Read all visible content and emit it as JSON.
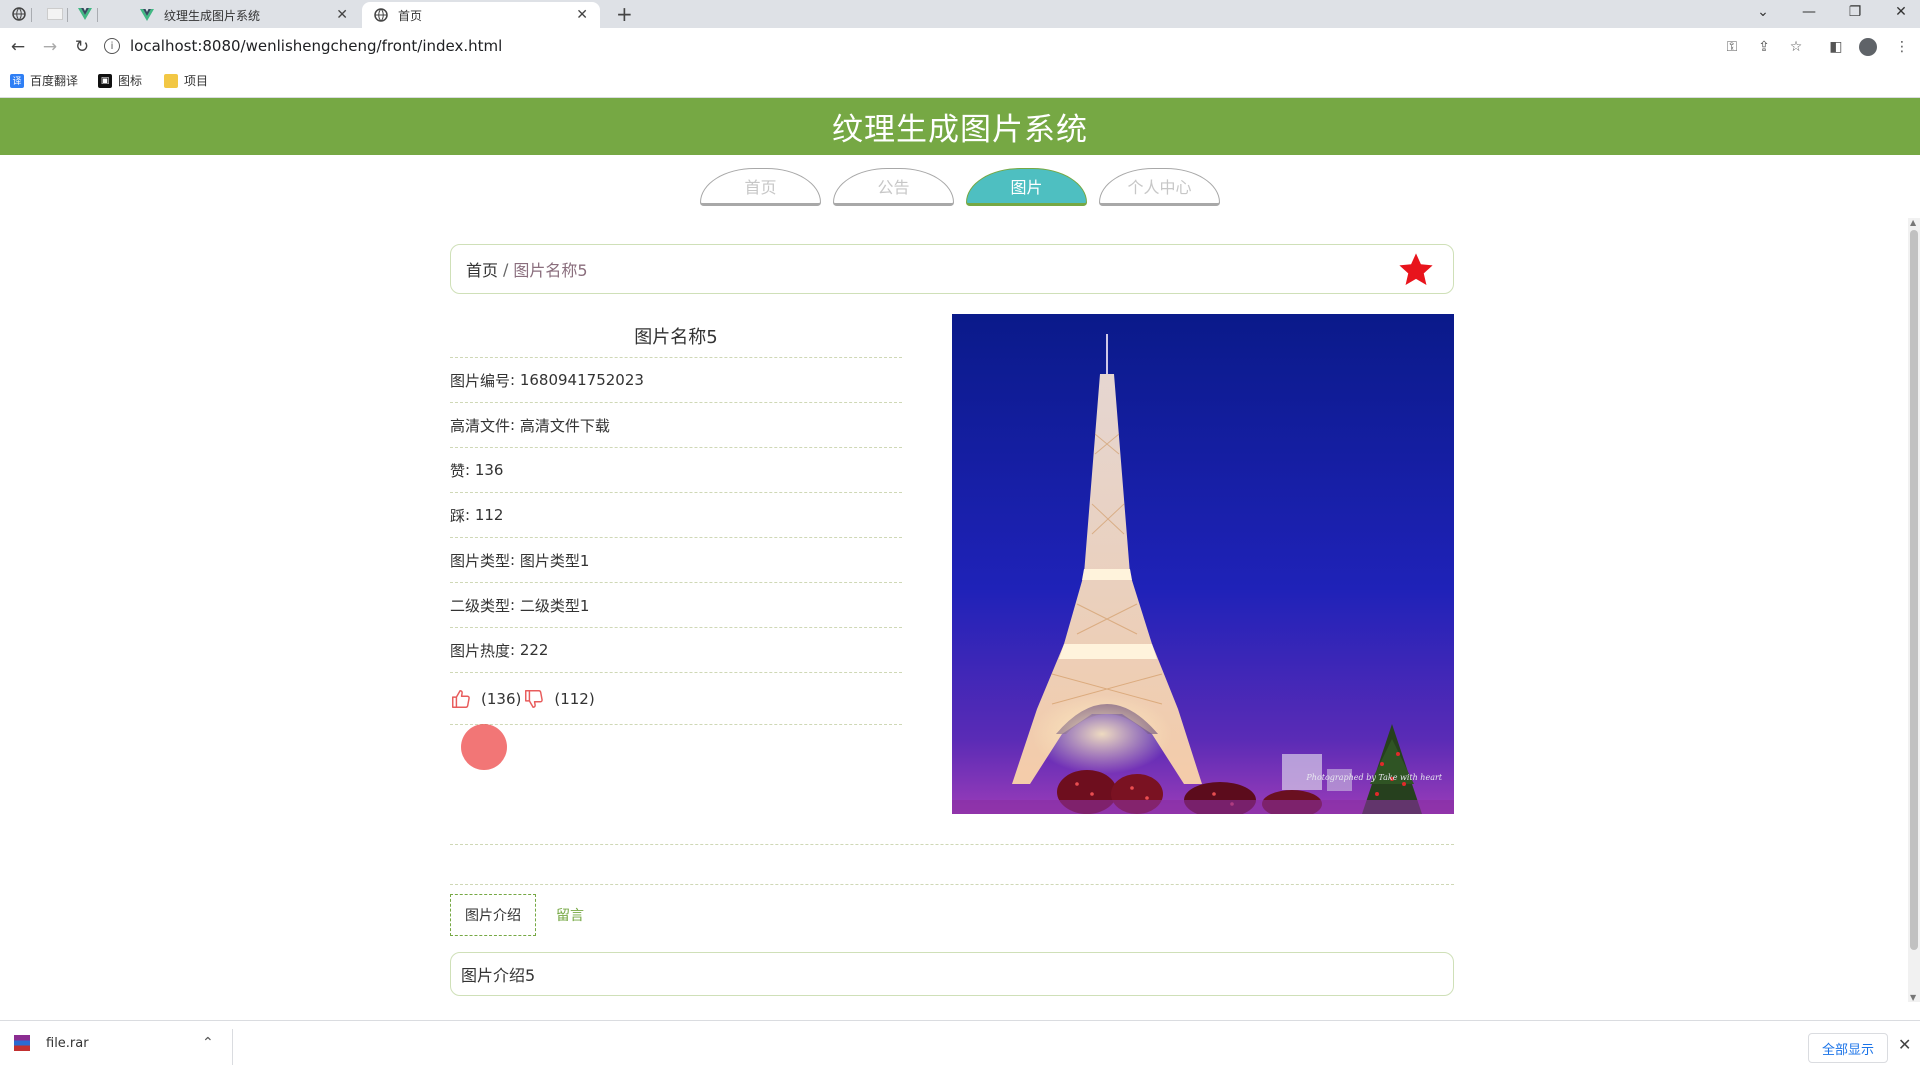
{
  "browser": {
    "tabs": [
      {
        "title": "纹理生成图片系统",
        "active": false
      },
      {
        "title": "首页",
        "active": true
      }
    ],
    "url": "localhost:8080/wenlishengcheng/front/index.html",
    "bookmarks": [
      {
        "label": "百度翻译",
        "icon": "translate-icon"
      },
      {
        "label": "图标",
        "icon": "image-icon"
      },
      {
        "label": "项目",
        "icon": "folder-icon"
      }
    ]
  },
  "header": {
    "title": "纹理生成图片系统"
  },
  "nav": {
    "items": [
      {
        "label": "首页",
        "active": false
      },
      {
        "label": "公告",
        "active": false
      },
      {
        "label": "图片",
        "active": true
      },
      {
        "label": "个人中心",
        "active": false
      }
    ]
  },
  "breadcrumb": {
    "home": "首页",
    "separator": "/",
    "current": "图片名称5"
  },
  "detail": {
    "title": "图片名称5",
    "fields": [
      {
        "label": "图片编号",
        "value": "1680941752023"
      },
      {
        "label": "高清文件",
        "value": "高清文件下载"
      },
      {
        "label": "赞",
        "value": "136"
      },
      {
        "label": "踩",
        "value": "112"
      },
      {
        "label": "图片类型",
        "value": "图片类型1"
      },
      {
        "label": "二级类型",
        "value": "二级类型1"
      },
      {
        "label": "图片热度",
        "value": "222"
      }
    ],
    "likes": "(136)",
    "dislikes": "(112)",
    "image_watermark": "Photographed by Take with heart"
  },
  "subtabs": [
    {
      "label": "图片介绍",
      "active": true
    },
    {
      "label": "留言",
      "active": false
    }
  ],
  "description": "图片介绍5",
  "downloads": {
    "file": "file.rar",
    "show_all": "全部显示"
  },
  "colors": {
    "header_green": "#76a844",
    "active_tab_teal": "#4ebfc1",
    "star_red": "#e8141c",
    "thumb_red": "#e85c5c"
  }
}
